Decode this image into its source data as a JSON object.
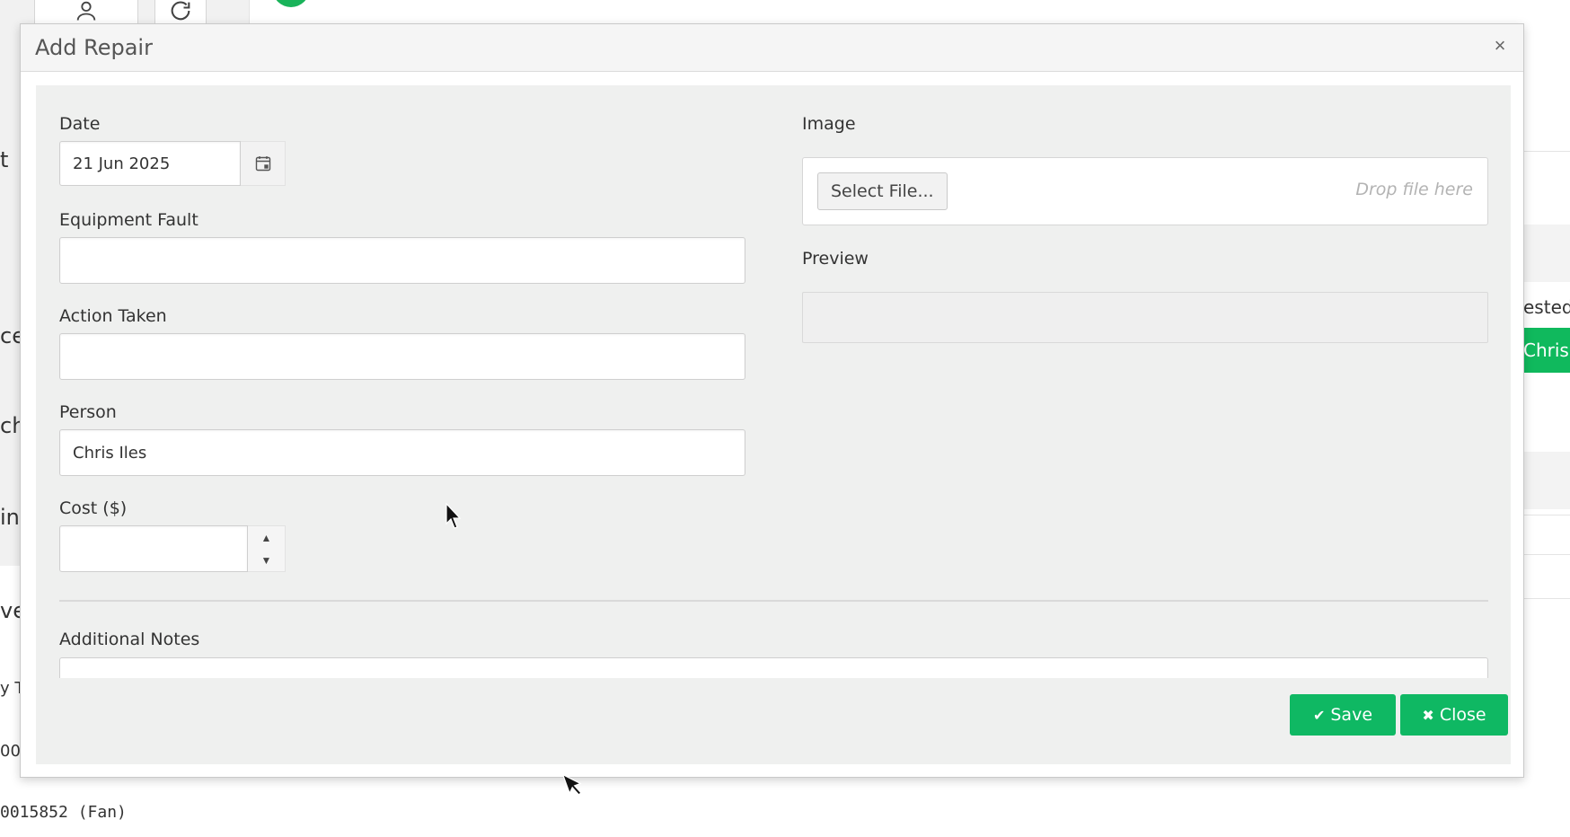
{
  "background": {
    "left_fragments": [
      "t",
      "ce",
      "ch",
      "in",
      "ve",
      "y T",
      "00"
    ],
    "bottom_label": "0015852 (Fan)",
    "right_fragments": {
      "text": "ested",
      "badge": "Chris Ile"
    }
  },
  "modal": {
    "title": "Add Repair",
    "close_glyph": "×",
    "fields": {
      "date": {
        "label": "Date",
        "value": "21 Jun 2025"
      },
      "equipment_fault": {
        "label": "Equipment Fault",
        "value": ""
      },
      "action_taken": {
        "label": "Action Taken",
        "value": ""
      },
      "person": {
        "label": "Person",
        "value": "Chris Iles"
      },
      "cost": {
        "label": "Cost ($)",
        "value": ""
      },
      "image": {
        "label": "Image",
        "button": "Select File...",
        "drop_hint": "Drop file here"
      },
      "preview": {
        "label": "Preview"
      },
      "notes": {
        "label": "Additional Notes",
        "value": ""
      }
    },
    "footer": {
      "save_label": "Save",
      "close_label": "Close",
      "accent": "#0fb863"
    }
  },
  "icons": [
    "user-icon",
    "refresh-icon",
    "calendar-icon",
    "check-icon",
    "times-icon",
    "close-icon",
    "mouse-cursor-icon"
  ]
}
